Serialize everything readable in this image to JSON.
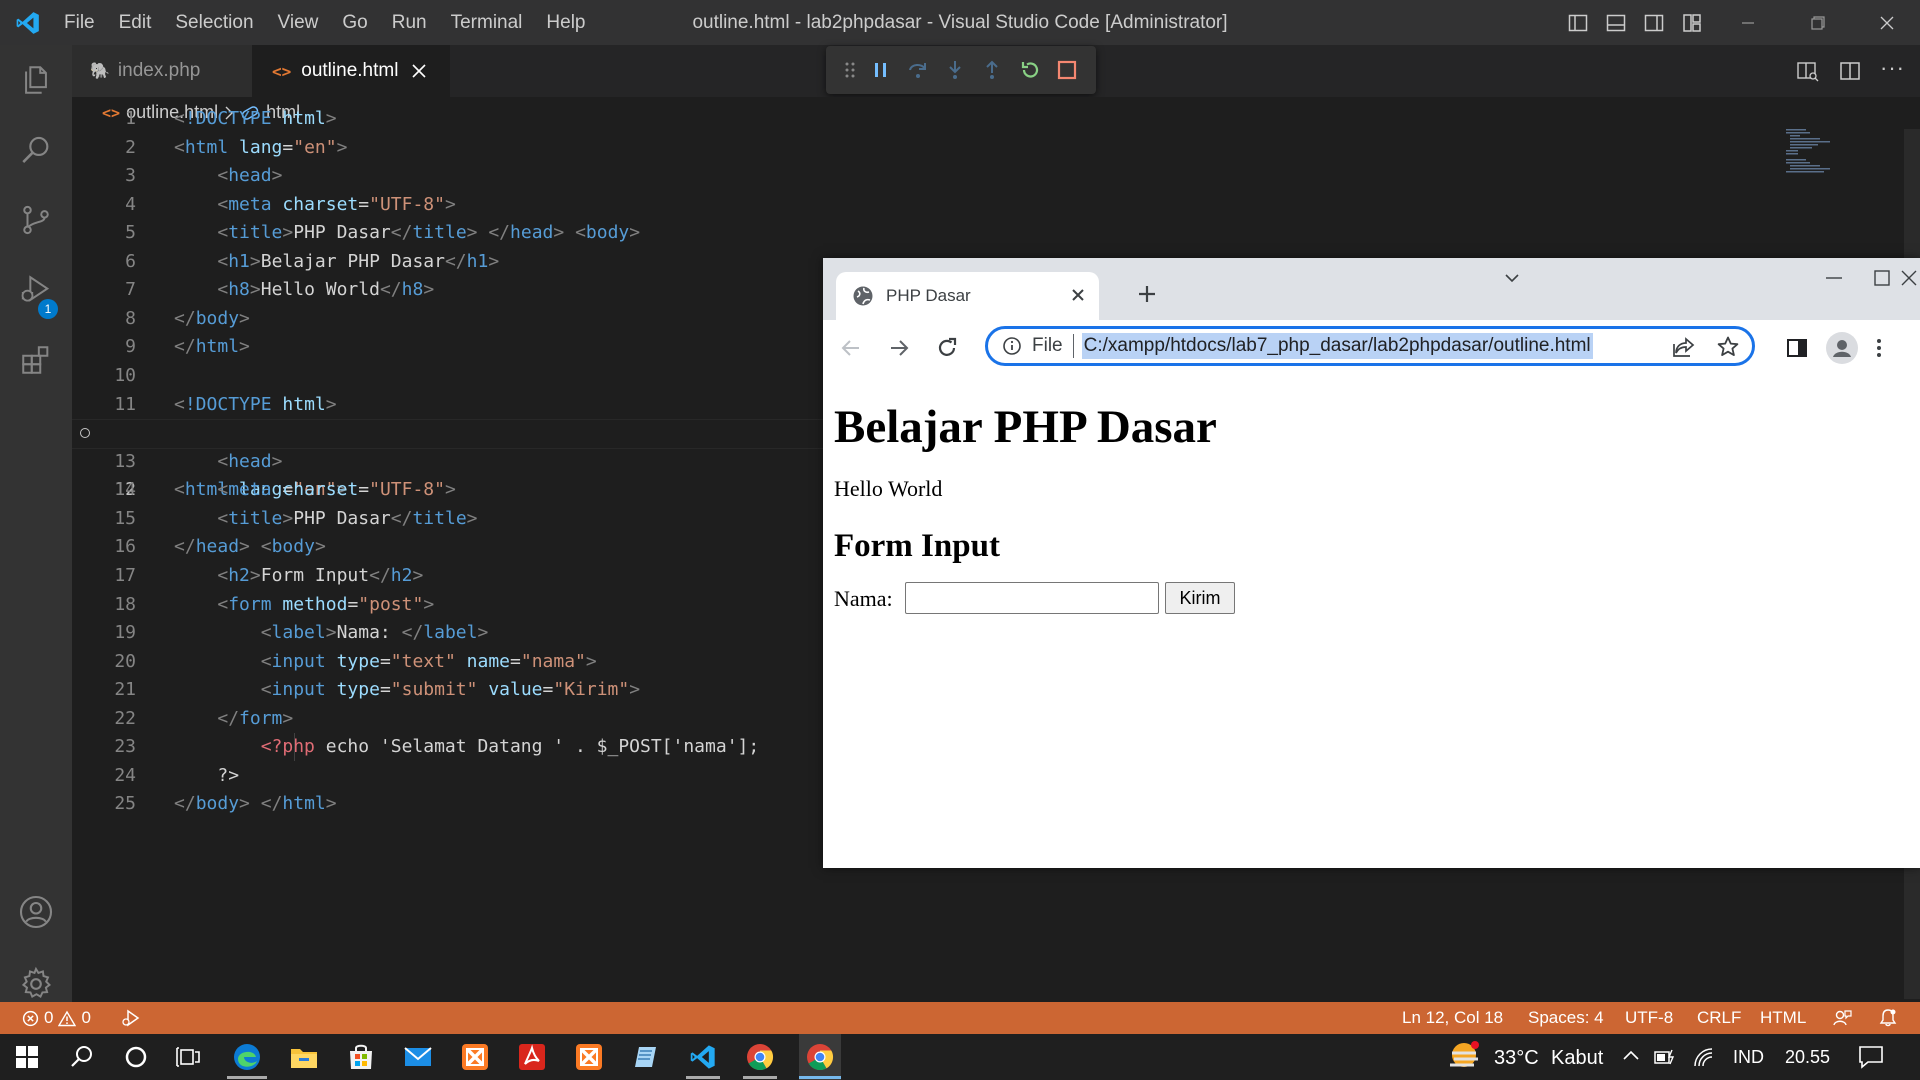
{
  "titlebar": {
    "menu": [
      "File",
      "Edit",
      "Selection",
      "View",
      "Go",
      "Run",
      "Terminal",
      "Help"
    ],
    "window_title": "outline.html - lab2phpdasar - Visual Studio Code [Administrator]"
  },
  "activity": {
    "debug_badge": "1"
  },
  "tabs": [
    {
      "label": "index.php",
      "active": false
    },
    {
      "label": "outline.html",
      "active": true
    }
  ],
  "breadcrumb": {
    "file": "outline.html",
    "symbol": "html"
  },
  "editor": {
    "active_line": 12,
    "lines": [
      {
        "n": "1"
      },
      {
        "n": "2"
      },
      {
        "n": "3"
      },
      {
        "n": "4"
      },
      {
        "n": "5"
      },
      {
        "n": "6"
      },
      {
        "n": "7"
      },
      {
        "n": "8"
      },
      {
        "n": "9"
      },
      {
        "n": "10"
      },
      {
        "n": "11"
      },
      {
        "n": "12"
      },
      {
        "n": "13"
      },
      {
        "n": "14"
      },
      {
        "n": "15"
      },
      {
        "n": "16"
      },
      {
        "n": "17"
      },
      {
        "n": "18"
      },
      {
        "n": "19"
      },
      {
        "n": "20"
      },
      {
        "n": "21"
      },
      {
        "n": "22"
      },
      {
        "n": "23"
      },
      {
        "n": "24"
      },
      {
        "n": "25"
      }
    ],
    "tokens": {
      "doctype": "<!DOCTYPE",
      "html": "html",
      "lang": "lang",
      "en": "\"en\"",
      "head": "head",
      "meta": "meta",
      "charset": "charset",
      "utf8": "\"UTF-8\"",
      "title": "title",
      "php_dasar": "PHP Dasar",
      "body": "body",
      "h1": "h1",
      "belajar": "Belajar PHP Dasar",
      "h8": "h8",
      "hello": "Hello World",
      "h2": "h2",
      "form_input": "Form Input",
      "form": "form",
      "method": "method",
      "post": "\"post\"",
      "label": "label",
      "nama_label": "Nama: ",
      "input": "input",
      "type": "type",
      "text": "\"text\"",
      "name": "name",
      "nama": "\"nama\"",
      "submit": "\"submit\"",
      "value": "value",
      "kirim": "\"Kirim\"",
      "php_open": "<?php",
      "php_echo": " echo 'Selamat Datang ' . $_POST['nama'];",
      "php_close": "?>"
    }
  },
  "statusbar": {
    "errors": "0",
    "warnings": "0",
    "position": "Ln 12, Col 18",
    "spaces": "Spaces: 4",
    "encoding": "UTF-8",
    "eol": "CRLF",
    "language": "HTML"
  },
  "browser": {
    "tab_title": "PHP Dasar",
    "omnibox_prefix": "File",
    "url": "C:/xampp/htdocs/lab7_php_dasar/lab2phpdasar/outline.html",
    "page": {
      "h1": "Belajar PHP Dasar",
      "hello": "Hello World",
      "h2": "Form Input",
      "label": "Nama:",
      "input_value": "",
      "button": "Kirim"
    }
  },
  "taskbar": {
    "weather_temp": "33°C",
    "weather_desc": "Kabut",
    "language": "IND",
    "time": "20.55"
  },
  "colors": {
    "statusbar": "#cc6633",
    "vscode_blue": "#23a9f2",
    "tag": "#569cd6",
    "attr": "#9cdcfe",
    "string": "#ce9178",
    "omnibox_focus": "#1a73e8"
  }
}
